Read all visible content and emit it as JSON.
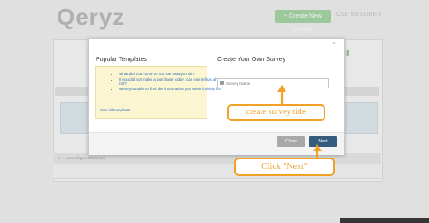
{
  "app": {
    "logo_text": "Qeryz",
    "create_button_label": "Create New Survey",
    "mesure_label": "CSE MESURER"
  },
  "background": {
    "section_title": "Unconfigured Surveys"
  },
  "modal": {
    "close_icon": "×",
    "popular_templates": {
      "title": "Popular Templates",
      "items": [
        "What did you come to our site today to do?",
        "If you did not make a purchase today, can you tell us why not?",
        "Were you able to find the information you were looking for?"
      ],
      "see_all": "See all templates..."
    },
    "create_own": {
      "title": "Create Your Own Survey",
      "input_placeholder": "Survey Name",
      "input_value": ""
    },
    "buttons": {
      "close": "Close",
      "next": "Next"
    }
  },
  "annotations": {
    "create_title": "create survey title",
    "click_next": "Click \"Next\""
  },
  "colors": {
    "accent_orange": "#f0a126",
    "next_blue": "#355c7d",
    "create_green": "#a6d6a6",
    "template_yellow": "#fcf5d2"
  }
}
